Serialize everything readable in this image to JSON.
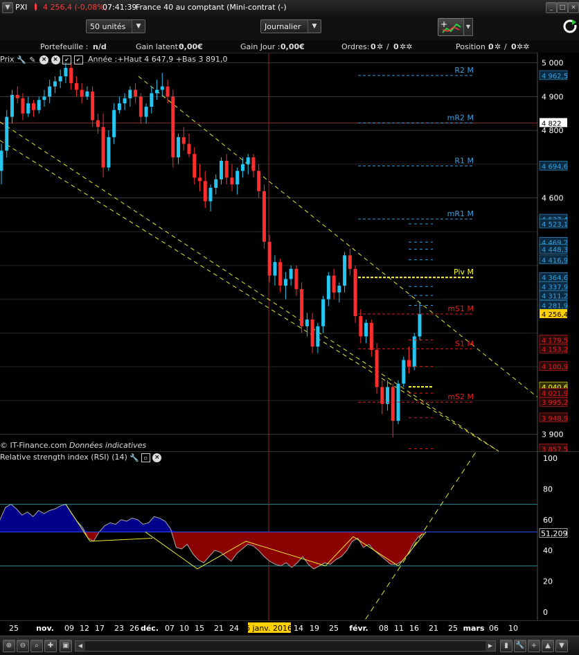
{
  "titlebar": {
    "symbol": "PXI",
    "change": "4 256,4 (-0,08%)",
    "time": "07:41:39",
    "instrument": "France 40 au comptant (Mini-contrat  (-)",
    "colors": {
      "change": "#ff3b3b"
    }
  },
  "toolbar": {
    "quantity": "50 unités",
    "period": "Journalier",
    "chart_button_icon": "chart-tools-icon",
    "refresh_icon": "refresh-icon"
  },
  "infobar": {
    "portefeuille_label": "Portefeuille :",
    "portefeuille_value": "n/d",
    "gain_latent_label": "Gain latent :",
    "gain_latent_value": "0,00€",
    "gain_jour_label": "Gain Jour :",
    "gain_jour_value": "0,00€",
    "ordres_label": "Ordres:",
    "ordres_value_a": "0",
    "ordres_sep": "/",
    "ordres_value_b": "0",
    "position_label": "Position :",
    "position_value_a": "0",
    "position_sep": "/",
    "position_value_b": "0"
  },
  "price_panel": {
    "legend_label": "Prix",
    "annual_note": "Année :+Haut 4 647,9 +Bas 3 891,0",
    "watermark_source": "IT-Finance.com",
    "watermark_note": "Données indicatives",
    "axis_ticks": [
      "5 000",
      "4 900",
      "4 800",
      "4 600",
      "3 900"
    ],
    "pivot_labels": [
      {
        "text": "R2 M",
        "price": "4 962,5",
        "color": "#3aa0e0"
      },
      {
        "text": "mR2 M",
        "price": "4 822",
        "color": "#3aa0e0"
      },
      {
        "text": "R1 M",
        "price": "4 694,6",
        "color": "#3aa0e0"
      },
      {
        "text": "mR1 M",
        "price": "4 537,4",
        "color": "#3aa0e0"
      },
      {
        "text": "Piv M",
        "price": "4 364,6",
        "color": "#ffff33"
      },
      {
        "text": "mS1 M",
        "price": "4 256,4",
        "color": "#e02020"
      },
      {
        "text": "S1 M",
        "price": "4 153,2",
        "color": "#e02020"
      },
      {
        "text": "mS2 M",
        "price": "3 995,2",
        "color": "#e02020"
      }
    ],
    "price_tags": [
      {
        "text": "4 962,5",
        "kind": "blue"
      },
      {
        "text": "4 822",
        "kind": "current-line"
      },
      {
        "text": "4 694,6",
        "kind": "blue"
      },
      {
        "text": "4 537,4",
        "kind": "blue"
      },
      {
        "text": "4 523,1",
        "kind": "blue"
      },
      {
        "text": "4 469,2",
        "kind": "blue"
      },
      {
        "text": "4 448,3",
        "kind": "blue"
      },
      {
        "text": "4 416,9",
        "kind": "blue"
      },
      {
        "text": "4 364,6",
        "kind": "blue"
      },
      {
        "text": "4 337,9",
        "kind": "blue"
      },
      {
        "text": "4 311,2",
        "kind": "blue"
      },
      {
        "text": "4 281,9",
        "kind": "blue"
      },
      {
        "text": "4 256,4",
        "kind": "current"
      },
      {
        "text": "4 179,5",
        "kind": "red"
      },
      {
        "text": "4 153,2",
        "kind": "red"
      },
      {
        "text": "4 100,9",
        "kind": "red"
      },
      {
        "text": "4 040,6",
        "kind": "yellow"
      },
      {
        "text": "4 021,9",
        "kind": "red"
      },
      {
        "text": "3 995,2",
        "kind": "red"
      },
      {
        "text": "3 948,9",
        "kind": "red"
      },
      {
        "text": "3 857,5",
        "kind": "red"
      }
    ],
    "colors": {
      "up": "#27c6f0",
      "down": "#ff2e2e",
      "channel": "#e8e830",
      "grid": "#3a3a3a"
    }
  },
  "rsi_panel": {
    "legend_label": "Relative strength index (RSI) (14)",
    "axis_ticks": [
      "100",
      "80",
      "60",
      "40",
      "20",
      "0"
    ],
    "current_value": "51,209",
    "colors": {
      "above": "#00008b",
      "below": "#8b0000",
      "trend": "#e8e830"
    }
  },
  "date_axis": {
    "ticks": [
      "25",
      "nov.",
      "09",
      "12",
      "17",
      "23",
      "26",
      "déc.",
      "07",
      "10",
      "15",
      "21",
      "24",
      "6 janv. 2016",
      "14",
      "19",
      "25",
      "févr.",
      "08",
      "11",
      "16",
      "21",
      "25",
      "mars",
      "06",
      "10"
    ],
    "highlight": "6 janv. 2016"
  },
  "chart_data": [
    {
      "type": "candlestick",
      "title": "",
      "note": "Année :+Haut 4 647,9 +Bas 3 891,0",
      "ylim": [
        3850,
        5030
      ],
      "yticks": [
        5000,
        4900,
        4800,
        4600,
        3900
      ],
      "bars": [
        [
          4680,
          4760,
          4640,
          4740
        ],
        [
          4740,
          4860,
          4720,
          4840
        ],
        [
          4840,
          4920,
          4820,
          4905
        ],
        [
          4905,
          4930,
          4880,
          4895
        ],
        [
          4895,
          4910,
          4830,
          4850
        ],
        [
          4850,
          4900,
          4840,
          4880
        ],
        [
          4880,
          4890,
          4840,
          4860
        ],
        [
          4860,
          4900,
          4850,
          4890
        ],
        [
          4890,
          4920,
          4870,
          4900
        ],
        [
          4900,
          4950,
          4880,
          4930
        ],
        [
          4930,
          4960,
          4910,
          4945
        ],
        [
          4945,
          4980,
          4925,
          4960
        ],
        [
          4960,
          5000,
          4940,
          4985
        ],
        [
          4985,
          5010,
          4920,
          4940
        ],
        [
          4940,
          4960,
          4900,
          4920
        ],
        [
          4920,
          4940,
          4880,
          4900
        ],
        [
          4900,
          4930,
          4890,
          4915
        ],
        [
          4915,
          4930,
          4810,
          4830
        ],
        [
          4830,
          4850,
          4790,
          4810
        ],
        [
          4810,
          4850,
          4660,
          4690
        ],
        [
          4690,
          4800,
          4680,
          4780
        ],
        [
          4780,
          4880,
          4760,
          4860
        ],
        [
          4860,
          4900,
          4850,
          4880
        ],
        [
          4880,
          4910,
          4860,
          4895
        ],
        [
          4895,
          4930,
          4870,
          4920
        ],
        [
          4920,
          4940,
          4880,
          4900
        ],
        [
          4900,
          4910,
          4820,
          4840
        ],
        [
          4840,
          4880,
          4820,
          4870
        ],
        [
          4870,
          4930,
          4850,
          4910
        ],
        [
          4910,
          4950,
          4890,
          4920
        ],
        [
          4920,
          4970,
          4900,
          4930
        ],
        [
          4930,
          4950,
          4880,
          4900
        ],
        [
          4900,
          4920,
          4690,
          4720
        ],
        [
          4720,
          4790,
          4700,
          4780
        ],
        [
          4780,
          4810,
          4740,
          4760
        ],
        [
          4760,
          4790,
          4720,
          4730
        ],
        [
          4730,
          4750,
          4640,
          4660
        ],
        [
          4660,
          4700,
          4620,
          4650
        ],
        [
          4650,
          4680,
          4570,
          4590
        ],
        [
          4590,
          4640,
          4560,
          4630
        ],
        [
          4630,
          4670,
          4610,
          4655
        ],
        [
          4655,
          4720,
          4640,
          4710
        ],
        [
          4710,
          4730,
          4640,
          4660
        ],
        [
          4660,
          4700,
          4620,
          4640
        ],
        [
          4640,
          4690,
          4610,
          4680
        ],
        [
          4680,
          4720,
          4660,
          4700
        ],
        [
          4700,
          4730,
          4670,
          4720
        ],
        [
          4720,
          4730,
          4660,
          4680
        ],
        [
          4680,
          4700,
          4600,
          4620
        ],
        [
          4620,
          4640,
          4450,
          4470
        ],
        [
          4470,
          4490,
          4350,
          4370
        ],
        [
          4370,
          4430,
          4340,
          4410
        ],
        [
          4410,
          4420,
          4320,
          4340
        ],
        [
          4340,
          4380,
          4300,
          4360
        ],
        [
          4360,
          4400,
          4340,
          4390
        ],
        [
          4390,
          4400,
          4310,
          4330
        ],
        [
          4330,
          4350,
          4200,
          4220
        ],
        [
          4220,
          4260,
          4190,
          4240
        ],
        [
          4240,
          4260,
          4140,
          4160
        ],
        [
          4160,
          4230,
          4140,
          4220
        ],
        [
          4220,
          4310,
          4200,
          4300
        ],
        [
          4300,
          4380,
          4280,
          4370
        ],
        [
          4370,
          4390,
          4300,
          4320
        ],
        [
          4320,
          4350,
          4290,
          4340
        ],
        [
          4340,
          4440,
          4320,
          4430
        ],
        [
          4430,
          4450,
          4370,
          4390
        ],
        [
          4390,
          4400,
          4230,
          4250
        ],
        [
          4250,
          4270,
          4170,
          4190
        ],
        [
          4190,
          4240,
          4170,
          4230
        ],
        [
          4230,
          4240,
          4130,
          4150
        ],
        [
          4150,
          4170,
          4020,
          4040
        ],
        [
          4040,
          4060,
          3960,
          3990
        ],
        [
          3990,
          4060,
          3970,
          4040
        ],
        [
          4040,
          4050,
          3891,
          3940
        ],
        [
          3940,
          4060,
          3930,
          4050
        ],
        [
          4050,
          4130,
          4040,
          4120
        ],
        [
          4120,
          4160,
          4080,
          4100
        ],
        [
          4100,
          4200,
          4090,
          4190
        ],
        [
          4190,
          4290,
          4180,
          4256
        ]
      ]
    },
    {
      "type": "area",
      "title": "Relative strength index (RSI) (14)",
      "ylim": [
        0,
        100
      ],
      "yticks": [
        100,
        80,
        60,
        40,
        20,
        0
      ],
      "baseline": 52,
      "values": [
        60,
        68,
        70,
        67,
        63,
        65,
        62,
        66,
        64,
        66,
        67,
        69,
        70,
        64,
        59,
        55,
        48,
        46,
        52,
        56,
        58,
        57,
        60,
        59,
        61,
        60,
        57,
        58,
        62,
        61,
        59,
        54,
        42,
        41,
        44,
        38,
        34,
        32,
        36,
        40,
        39,
        36,
        33,
        38,
        41,
        44,
        43,
        40,
        36,
        33,
        31,
        30,
        32,
        29,
        32,
        36,
        31,
        28,
        30,
        32,
        31,
        34,
        36,
        40,
        46,
        48,
        42,
        44,
        40,
        37,
        34,
        31,
        31,
        33,
        37,
        44,
        49,
        51
      ]
    }
  ]
}
